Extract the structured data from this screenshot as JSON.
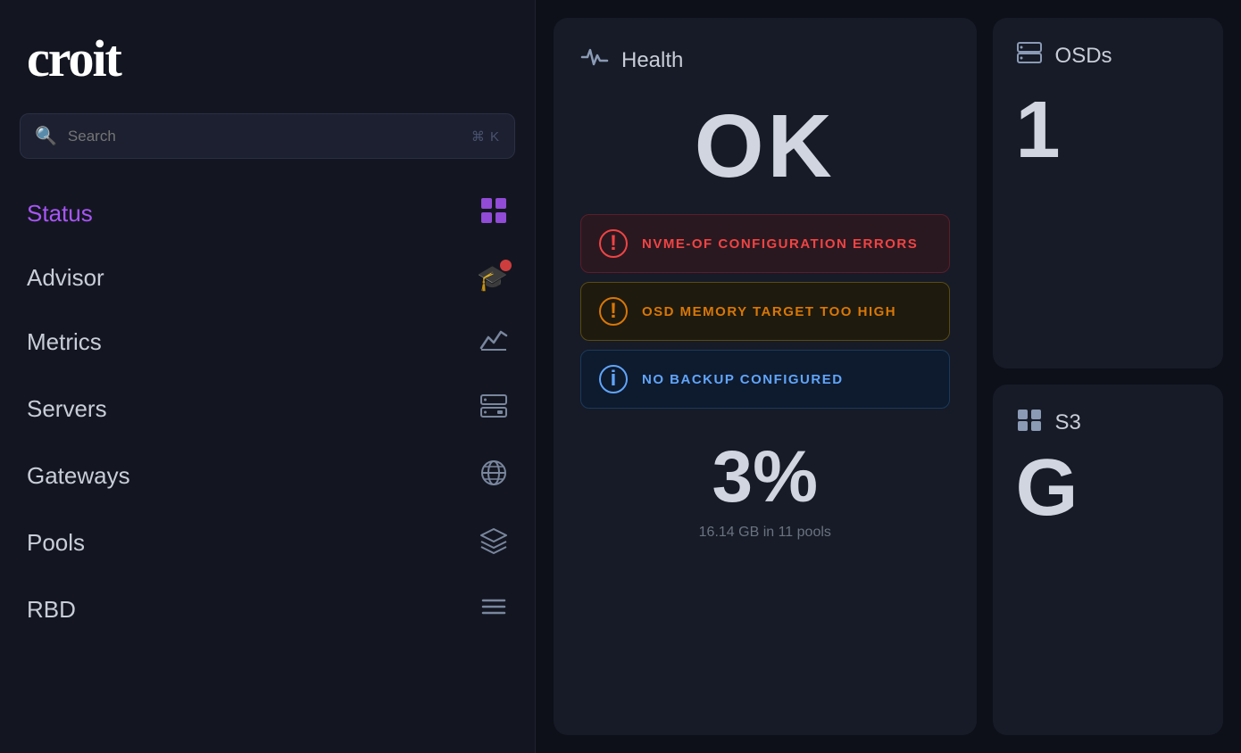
{
  "sidebar": {
    "logo": "croit",
    "search": {
      "placeholder": "Search",
      "kbd": "⌘ K"
    },
    "nav_items": [
      {
        "id": "status",
        "label": "Status",
        "icon": "grid",
        "active": true
      },
      {
        "id": "advisor",
        "label": "Advisor",
        "icon": "graduation",
        "active": false,
        "badge": true
      },
      {
        "id": "metrics",
        "label": "Metrics",
        "icon": "chart",
        "active": false
      },
      {
        "id": "servers",
        "label": "Servers",
        "icon": "server",
        "active": false
      },
      {
        "id": "gateways",
        "label": "Gateways",
        "icon": "globe",
        "active": false
      },
      {
        "id": "pools",
        "label": "Pools",
        "icon": "layers",
        "active": false
      },
      {
        "id": "rbd",
        "label": "RBD",
        "icon": "menu",
        "active": false
      }
    ]
  },
  "health_card": {
    "title": "Health",
    "status": "OK",
    "alerts": [
      {
        "type": "error",
        "text": "NVME-OF CONFIGURATION ERRORS"
      },
      {
        "type": "warning",
        "text": "OSD MEMORY TARGET TOO HIGH"
      },
      {
        "type": "info",
        "text": "NO BACKUP CONFIGURED"
      }
    ],
    "usage_percent": "3%",
    "storage_detail": "16.14 GB in 11 pools"
  },
  "osds_card": {
    "title": "OSDs",
    "value": "1"
  },
  "s3_card": {
    "title": "S3",
    "value": "G"
  }
}
